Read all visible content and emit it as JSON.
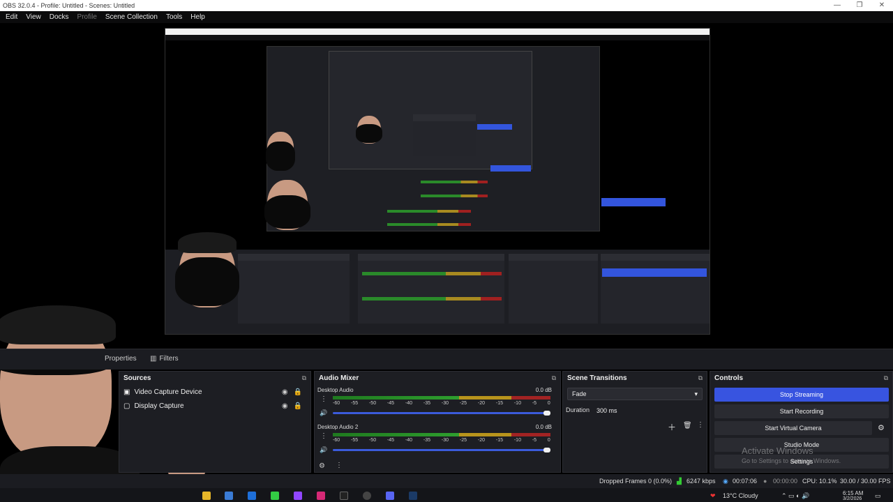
{
  "window": {
    "title": "OBS 32.0.4 - Profile: Untitled - Scenes: Untitled",
    "controls": [
      "—",
      "❐",
      "✕"
    ]
  },
  "menu": {
    "items": [
      "Edit",
      "View",
      "Docks",
      "Profile",
      "Scene Collection",
      "Tools",
      "Help"
    ]
  },
  "tabs": {
    "properties": "Properties",
    "filters": "Filters"
  },
  "sources": {
    "title": "Sources",
    "items": [
      "Video Capture Device",
      "Display Capture"
    ]
  },
  "mixer": {
    "title": "Audio Mixer",
    "channels": [
      {
        "name": "Desktop Audio",
        "db": "0.0 dB"
      },
      {
        "name": "Desktop Audio 2",
        "db": "0.0 dB"
      }
    ],
    "scale": [
      "-60",
      "-55",
      "-50",
      "-45",
      "-40",
      "-35",
      "-30",
      "-25",
      "-20",
      "-15",
      "-10",
      "-5",
      "0"
    ]
  },
  "transitions": {
    "title": "Scene Transitions",
    "selected": "Fade",
    "duration_label": "Duration",
    "duration_value": "300 ms"
  },
  "controls": {
    "title": "Controls",
    "stop_streaming": "Stop Streaming",
    "start_recording": "Start Recording",
    "start_virtual_camera": "Start Virtual Camera",
    "studio_mode": "Studio Mode",
    "settings": "Settings"
  },
  "watermark": {
    "line1": "Activate Windows",
    "line2": "Go to Settings to activate Windows."
  },
  "status": {
    "dropped": "Dropped Frames 0 (0.0%)",
    "bitrate": "6247 kbps",
    "stream_time": "00:07:06",
    "rec_time": "00:00:00",
    "cpu": "CPU: 10.1%",
    "fps": "30.00 / 30.00 FPS"
  },
  "taskbar": {
    "weather": "13°C  Cloudy",
    "time": "6:15 AM",
    "date": "3/2/2026"
  },
  "colors": {
    "accent": "#3854e0",
    "panel": "#1d1e23"
  }
}
